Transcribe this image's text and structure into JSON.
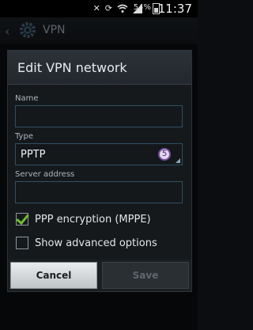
{
  "status": {
    "battery_percent": "54%",
    "time": "11:37",
    "icons": [
      "mute-icon",
      "sync-icon",
      "wifi-icon",
      "signal-icon"
    ]
  },
  "app": {
    "title": "VPN"
  },
  "dialog": {
    "title": "Edit VPN network",
    "fields": {
      "name": {
        "label": "Name",
        "value": ""
      },
      "type": {
        "label": "Type",
        "value": "PPTP",
        "badge": "5"
      },
      "server": {
        "label": "Server address",
        "value": ""
      }
    },
    "options": {
      "ppp_encryption": {
        "label": "PPP encryption (MPPE)",
        "checked": true
      },
      "advanced": {
        "label": "Show advanced options",
        "checked": false
      }
    },
    "buttons": {
      "cancel": "Cancel",
      "save": "Save"
    }
  },
  "colors": {
    "accent": "#2f4f63",
    "check": "#6ebd2b",
    "badge_ring": "#7a4fa1"
  }
}
